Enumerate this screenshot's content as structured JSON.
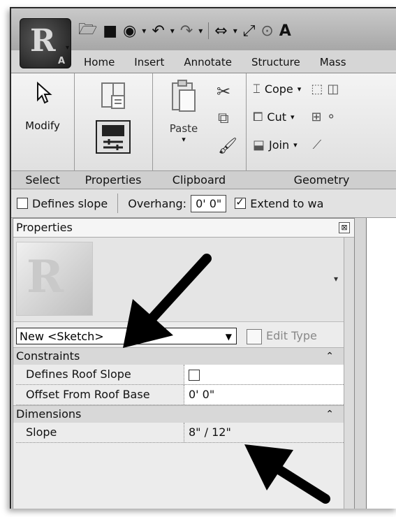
{
  "ribbon_tabs": [
    "Home",
    "Insert",
    "Annotate",
    "Structure",
    "Mass"
  ],
  "app_menu": {
    "letter": "R",
    "sub": "A"
  },
  "ribbon": {
    "modify_label": "Modify",
    "paste_label": "Paste",
    "cope_label": "Cope",
    "cut_label": "Cut",
    "join_label": "Join",
    "panels": {
      "select": "Select",
      "properties": "Properties",
      "clipboard": "Clipboard",
      "geometry": "Geometry"
    }
  },
  "options_bar": {
    "defines_slope_label": "Defines slope",
    "defines_slope_checked": false,
    "overhang_label": "Overhang:",
    "overhang_value": "0'  0\"",
    "extend_label": "Extend to wa",
    "extend_checked": true
  },
  "properties": {
    "title": "Properties",
    "type_selector": "New <Sketch>",
    "edit_type_label": "Edit Type",
    "sections": [
      {
        "name": "Constraints",
        "rows": [
          {
            "name": "Defines Roof Slope",
            "value": ""
          },
          {
            "name": "Offset From Roof Base",
            "value": "0'  0\""
          }
        ]
      },
      {
        "name": "Dimensions",
        "rows": [
          {
            "name": "Slope",
            "value": "8\" / 12\""
          }
        ]
      }
    ]
  }
}
